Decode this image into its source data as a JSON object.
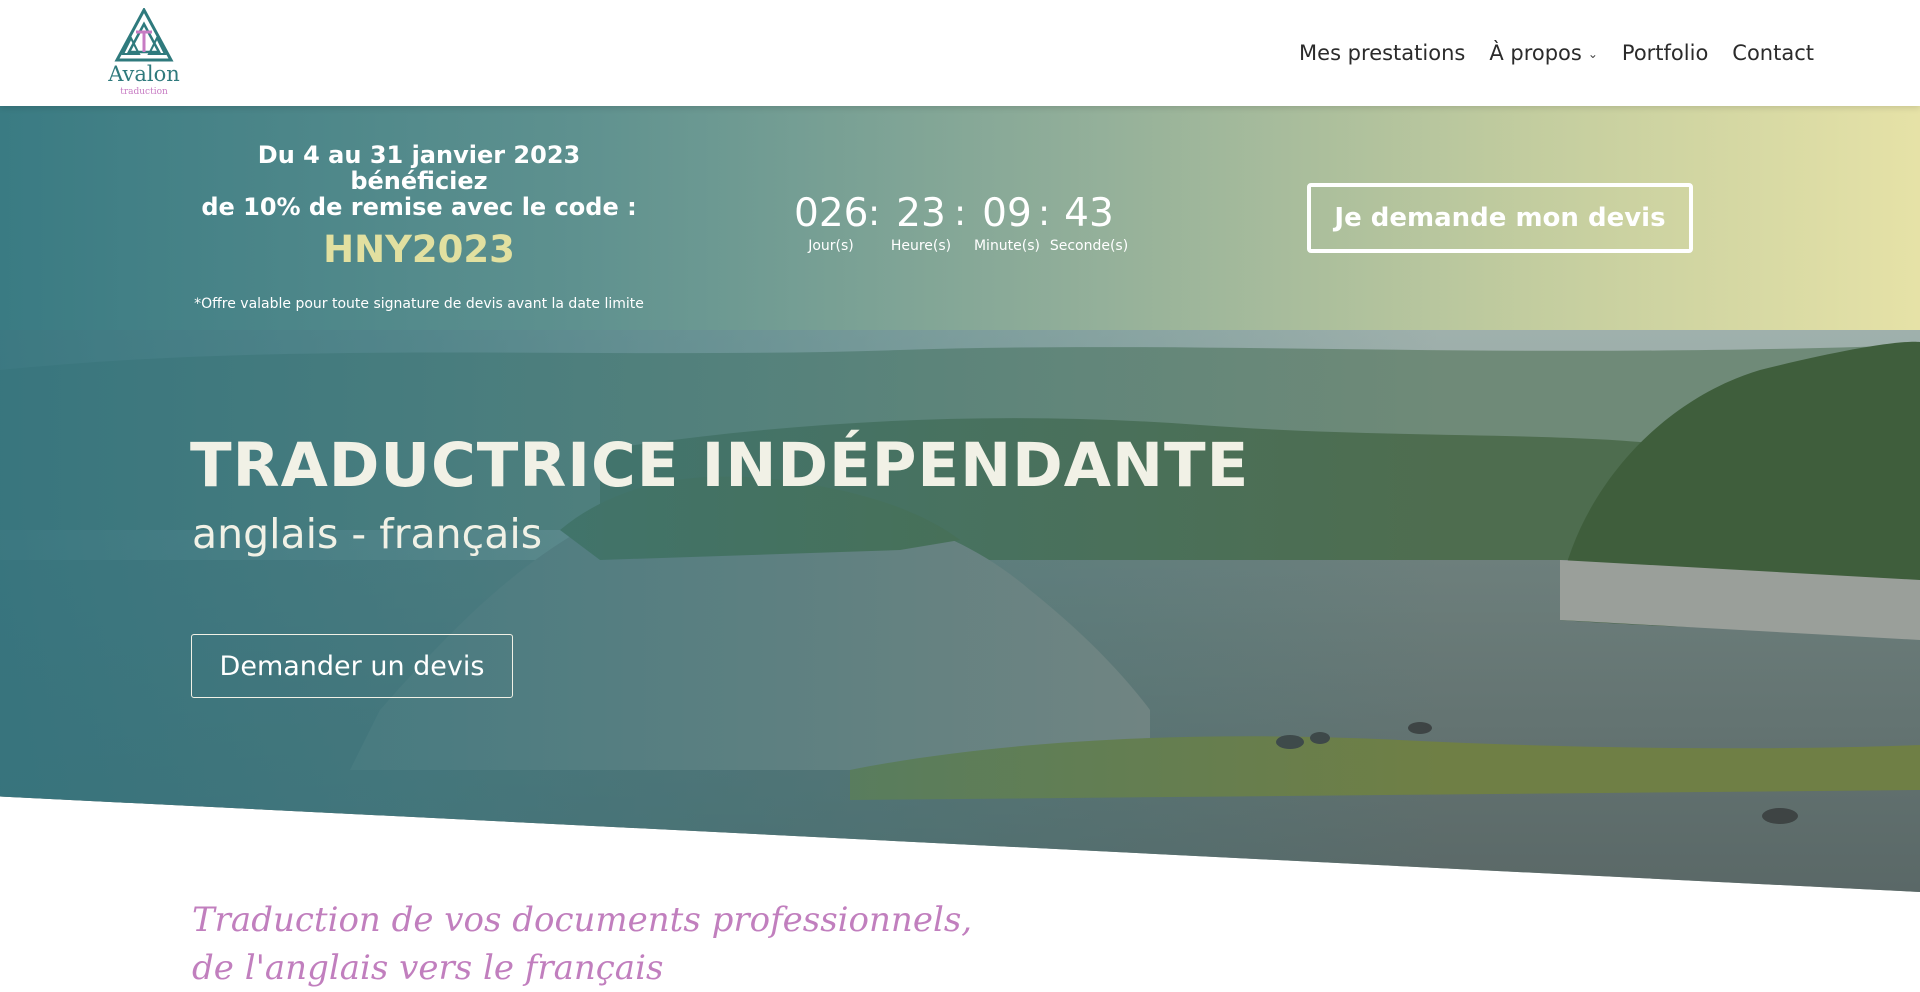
{
  "header": {
    "logo": {
      "name": "Avalon",
      "sub": "traduction",
      "icon": "triangle-logo-icon"
    },
    "nav": [
      {
        "label": "Mes prestations",
        "has_dropdown": false
      },
      {
        "label": "À propos",
        "has_dropdown": true
      },
      {
        "label": "Portfolio",
        "has_dropdown": false
      },
      {
        "label": "Contact",
        "has_dropdown": false
      }
    ]
  },
  "promo": {
    "line1": "Du 4 au 31 janvier 2023 bénéficiez",
    "line2": "de 10% de remise avec le code :",
    "code": "HNY2023",
    "note": "*Offre valable pour toute signature de devis avant la date limite",
    "countdown": [
      {
        "value": "026",
        "label": "Jour(s)"
      },
      {
        "value": "23",
        "label": "Heure(s)"
      },
      {
        "value": "09",
        "label": "Minute(s)"
      },
      {
        "value": "43",
        "label": "Seconde(s)"
      }
    ],
    "button": "Je demande mon devis"
  },
  "hero": {
    "title": "TRADUCTRICE INDÉPENDANTE",
    "subtitle": "anglais - français",
    "button": "Demander un devis"
  },
  "tagline": {
    "line1": "Traduction de vos documents professionnels,",
    "line2": "de l'anglais vers le français"
  },
  "colors": {
    "teal": "#3a7b83",
    "pale_yellow": "#e6e2a7",
    "code_yellow": "#e2e0a0",
    "tagline_pink": "#c17fbe",
    "logo_teal": "#2f7a7d"
  }
}
